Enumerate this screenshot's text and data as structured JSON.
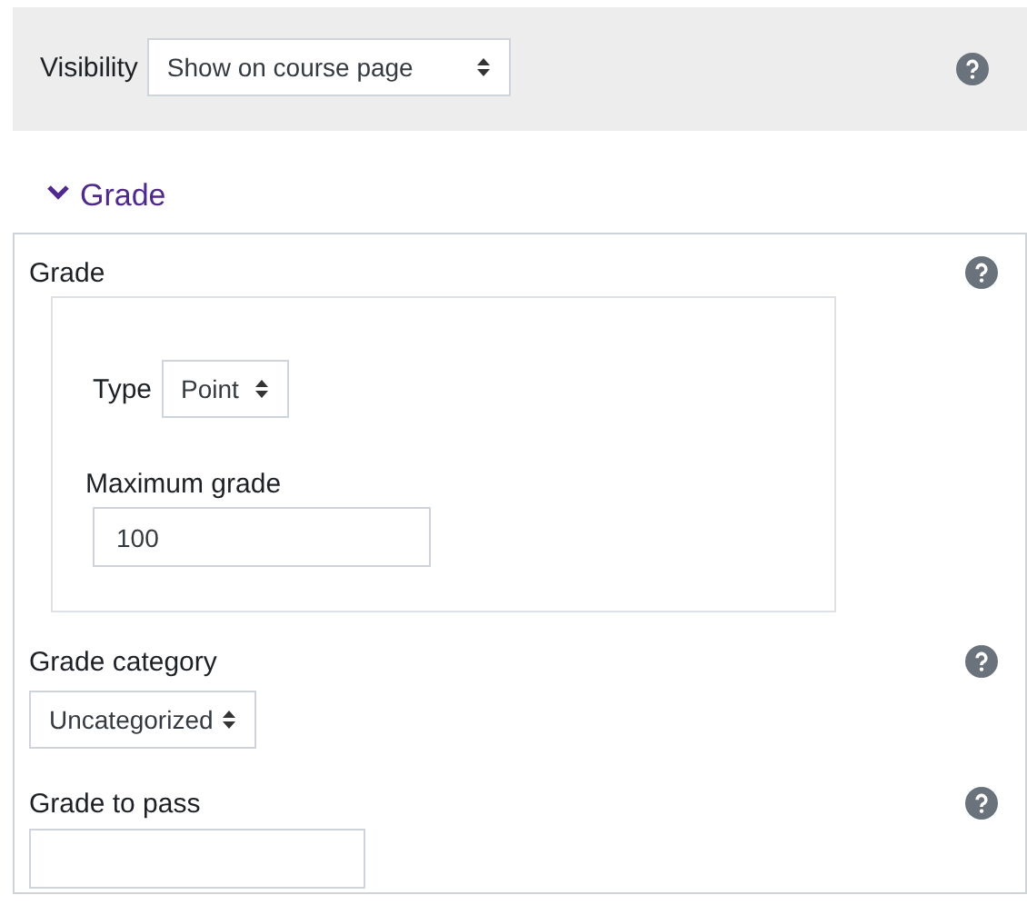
{
  "visibility": {
    "label": "Visibility",
    "value": "Show on course page"
  },
  "section": {
    "title": "Grade",
    "expanded": true,
    "grade": {
      "label": "Grade",
      "type_label": "Type",
      "type_value": "Point",
      "max_label": "Maximum grade",
      "max_value": "100"
    },
    "category": {
      "label": "Grade category",
      "value": "Uncategorized"
    },
    "pass": {
      "label": "Grade to pass"
    }
  }
}
